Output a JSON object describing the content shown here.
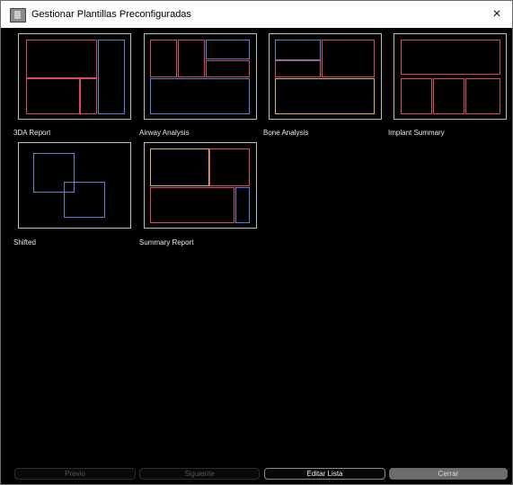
{
  "window": {
    "title": "Gestionar Plantillas Preconfiguradas",
    "close_symbol": "×"
  },
  "templates": [
    {
      "label": "3DA Report"
    },
    {
      "label": "Airway Analysis"
    },
    {
      "label": "Bone Analysis"
    },
    {
      "label": "Implant Summary"
    },
    {
      "label": "Shifted"
    },
    {
      "label": "Summary Report"
    }
  ],
  "footer": {
    "previous_label": "Previo",
    "next_label": "Siguiente",
    "edit_label": "Editar Lista",
    "close_label": "Cerrar"
  },
  "colors": {
    "red": "#d84a63",
    "blue": "#5f7fd1",
    "yellow": "#d8b85a"
  }
}
